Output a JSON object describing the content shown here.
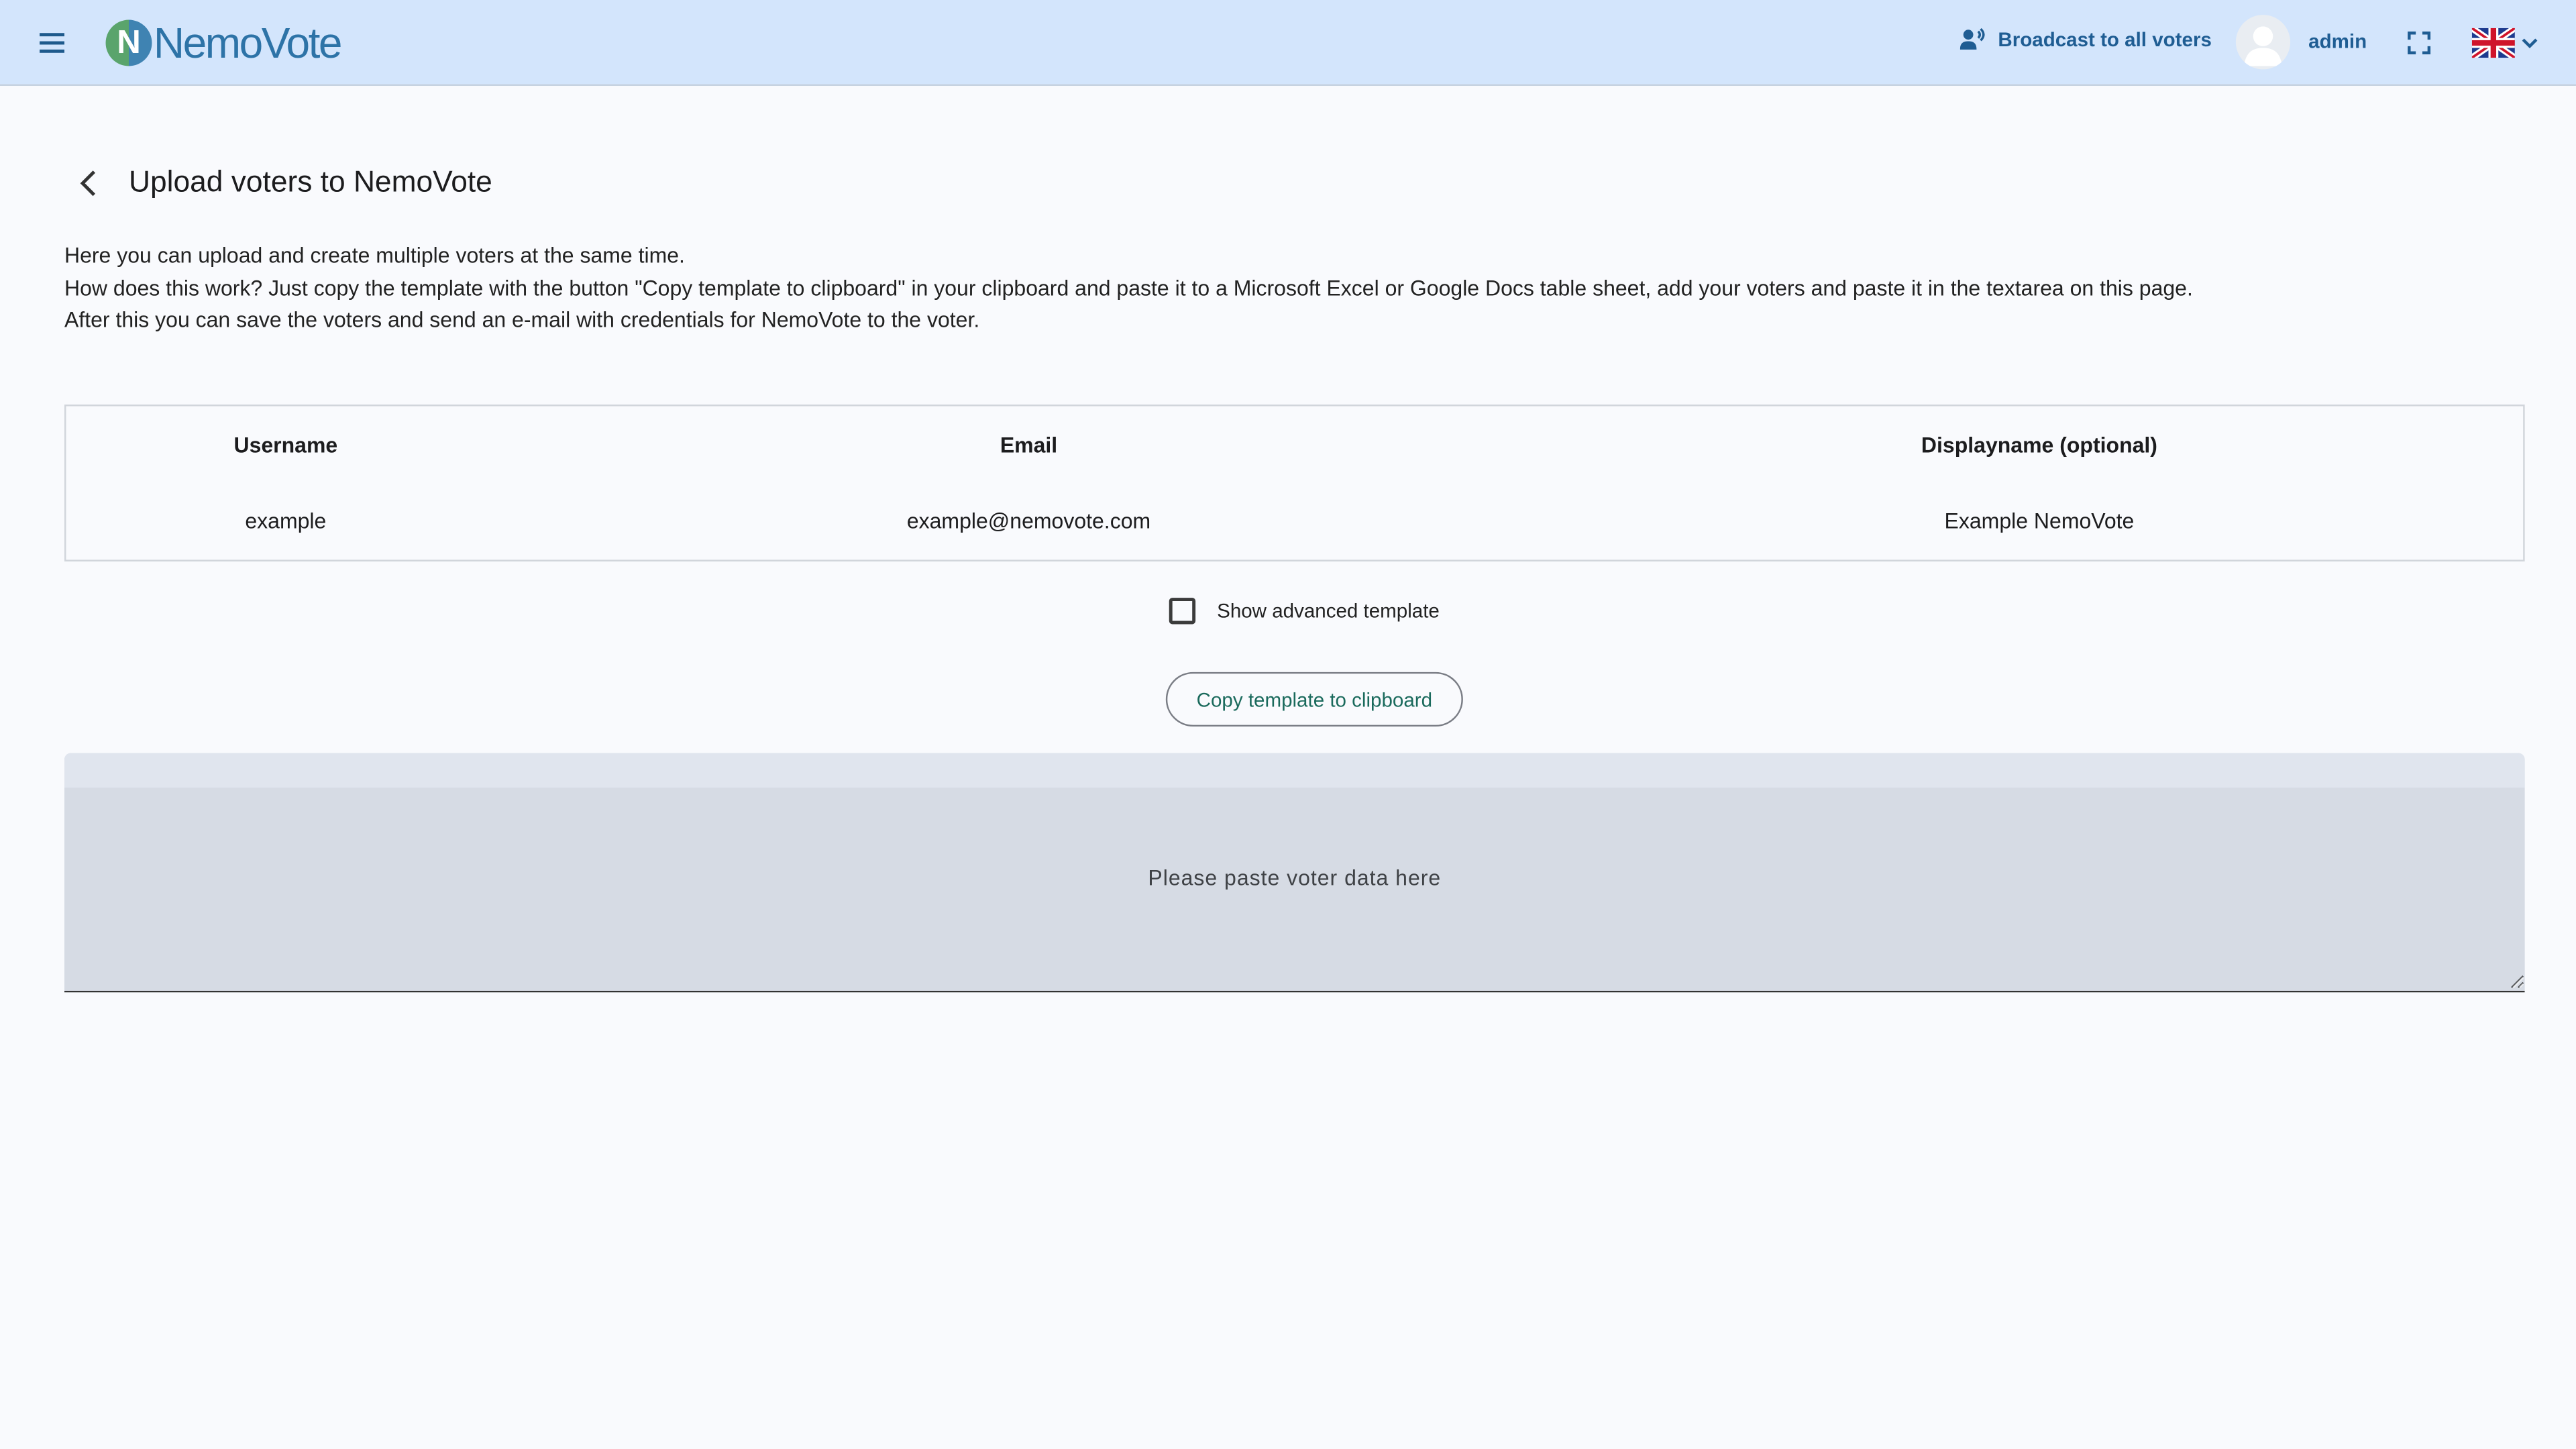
{
  "header": {
    "logo_letter": "N",
    "logo_text": "NemoVote",
    "broadcast_label": "Broadcast to all voters",
    "user_name": "admin",
    "language": "en-GB",
    "colors": {
      "bar_bg": "#d3e5fc",
      "accent": "#1f5d93"
    }
  },
  "page": {
    "title": "Upload voters to NemoVote",
    "intro": [
      "Here you can upload and create multiple voters at the same time.",
      "How does this work? Just copy the template with the button \"Copy template to clipboard\" in your clipboard and paste it to a Microsoft Excel or Google Docs table sheet, add your voters and paste it in the textarea on this page.",
      "After this you can save the voters and send an e-mail with credentials for NemoVote to the voter."
    ]
  },
  "template_table": {
    "columns": [
      "Username",
      "Email",
      "Displayname (optional)"
    ],
    "rows": [
      [
        "example",
        "example@nemovote.com",
        "Example NemoVote"
      ]
    ]
  },
  "advanced_template": {
    "label": "Show advanced template",
    "checked": false
  },
  "copy_button": {
    "label": "Copy template to clipboard"
  },
  "paste_area": {
    "placeholder": "Please paste voter data here",
    "value": ""
  }
}
